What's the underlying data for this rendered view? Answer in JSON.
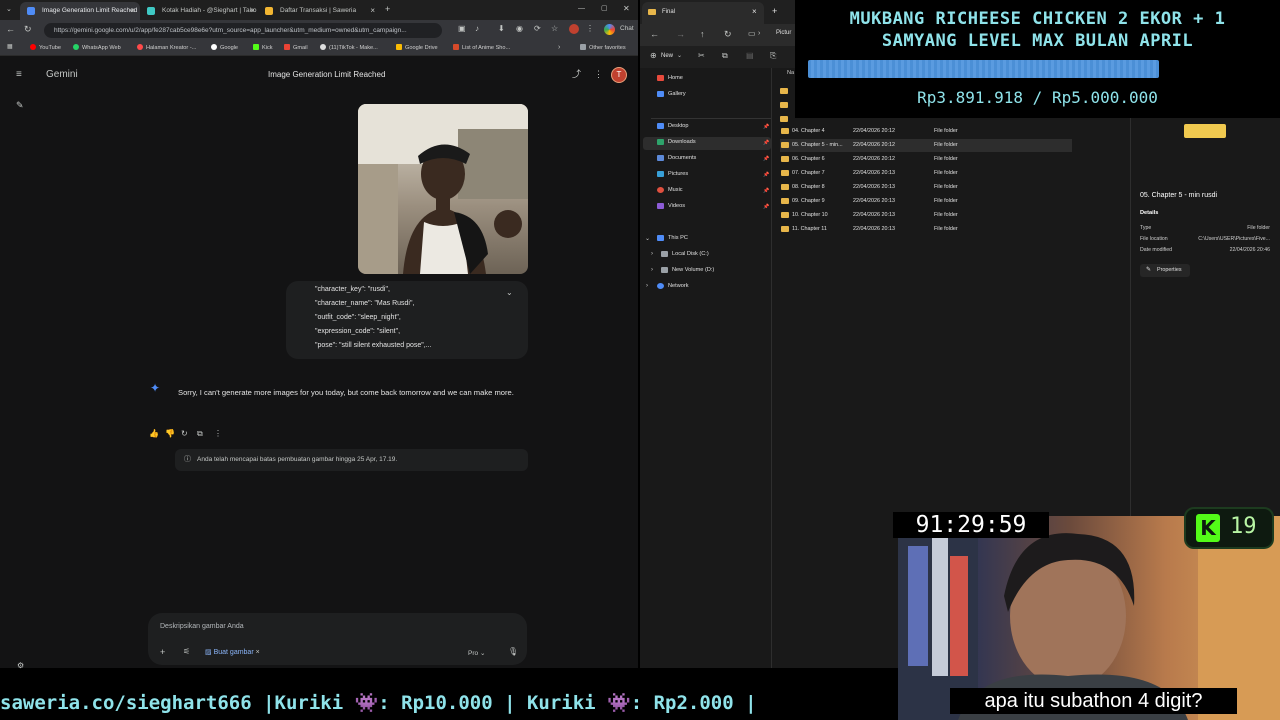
{
  "browser": {
    "tabs": [
      {
        "title": "Image Generation Limit Reached",
        "color": "#4f8cf7"
      },
      {
        "title": "Kotak Hadiah - @Sieghart | Tako",
        "color": "#3fc9c4"
      },
      {
        "title": "Daftar Transaksi | Saweria",
        "color": "#f2b632"
      }
    ],
    "url": "https://gemini.google.com/u/2/app/fe287cab5ce98e6e?utm_source=app_launcher&utm_medium=owned&utm_campaign...",
    "chat_ext_label": "Chat",
    "bookmarks": [
      "YouTube",
      "WhatsApp Web",
      "Halaman Kreator -...",
      "Google",
      "Kick",
      "Gmail",
      "(11)TikTok - Make...",
      "Google Drive",
      "List of Anime Sho...",
      "Other favorites"
    ]
  },
  "gemini": {
    "brand": "Gemini",
    "conversation_title": "Image Generation Limit Reached",
    "avatar_letter": "T",
    "prompt_lines": [
      "\"character_key\": \"rusdi\",",
      "\"character_name\": \"Mas Rusdi\",",
      "\"outfit_code\": \"sleep_night\",",
      "\"expression_code\": \"silent\",",
      "\"pose\": \"still silent exhausted pose\",..."
    ],
    "reply": "Sorry, I can't generate more images for you today, but come back tomorrow and we can make more.",
    "notice": "Anda telah mencapai batas pembuatan gambar hingga 25 Apr, 17.19.",
    "input_placeholder": "Deskripsikan gambar Anda",
    "chip_label": "Buat gambar",
    "model_label": "Pro"
  },
  "explorer": {
    "tab_title": "Final",
    "address_partial": "Pictur",
    "new_label": "New",
    "nav": {
      "home": "Home",
      "gallery": "Gallery",
      "pinned": [
        "Desktop",
        "Downloads",
        "Documents",
        "Pictures",
        "Music",
        "Videos"
      ],
      "this_pc": "This PC",
      "drives": [
        "Local Disk (C:)",
        "New Volume (D:)"
      ],
      "network": "Network"
    },
    "column_name_partial": "Na",
    "rows": [
      {
        "name": "04. Chapter 4",
        "date": "22/04/2026 20:12",
        "type": "File folder"
      },
      {
        "name": "05. Chapter 5 - min...",
        "date": "22/04/2026 20:12",
        "type": "File folder"
      },
      {
        "name": "06. Chapter 6",
        "date": "22/04/2026 20:12",
        "type": "File folder"
      },
      {
        "name": "07. Chapter 7",
        "date": "22/04/2026 20:13",
        "type": "File folder"
      },
      {
        "name": "08. Chapter 8",
        "date": "22/04/2026 20:13",
        "type": "File folder"
      },
      {
        "name": "09. Chapter 9",
        "date": "22/04/2026 20:13",
        "type": "File folder"
      },
      {
        "name": "10. Chapter 10",
        "date": "22/04/2026 20:13",
        "type": "File folder"
      },
      {
        "name": "11. Chapter 11",
        "date": "22/04/2026 20:13",
        "type": "File folder"
      }
    ],
    "details": {
      "title": "05. Chapter 5 - min rusdi",
      "section": "Details",
      "type_label": "Type",
      "type_value": "File folder",
      "location_label": "File location",
      "location_value": "C:\\Users\\USER\\Pictures\\Five...",
      "modified_label": "Date modified",
      "modified_value": "22/04/2026 20:46",
      "properties_label": "Properties"
    }
  },
  "stream": {
    "goal_title_1": "MUKBANG RICHEESE CHICKEN 2 EKOR + 1",
    "goal_title_2": "SAMYANG LEVEL MAX BULAN APRIL",
    "goal_amount": "Rp3.891.918 / Rp5.000.000",
    "goal_progress": 0.778,
    "timer": "91:29:59",
    "kick_count": "19",
    "ticker": "saweria.co/sieghart666 |Kuriki 👾: Rp10.000 | Kuriki 👾: Rp2.000 |",
    "caption": "apa itu subathon 4 digit?"
  }
}
